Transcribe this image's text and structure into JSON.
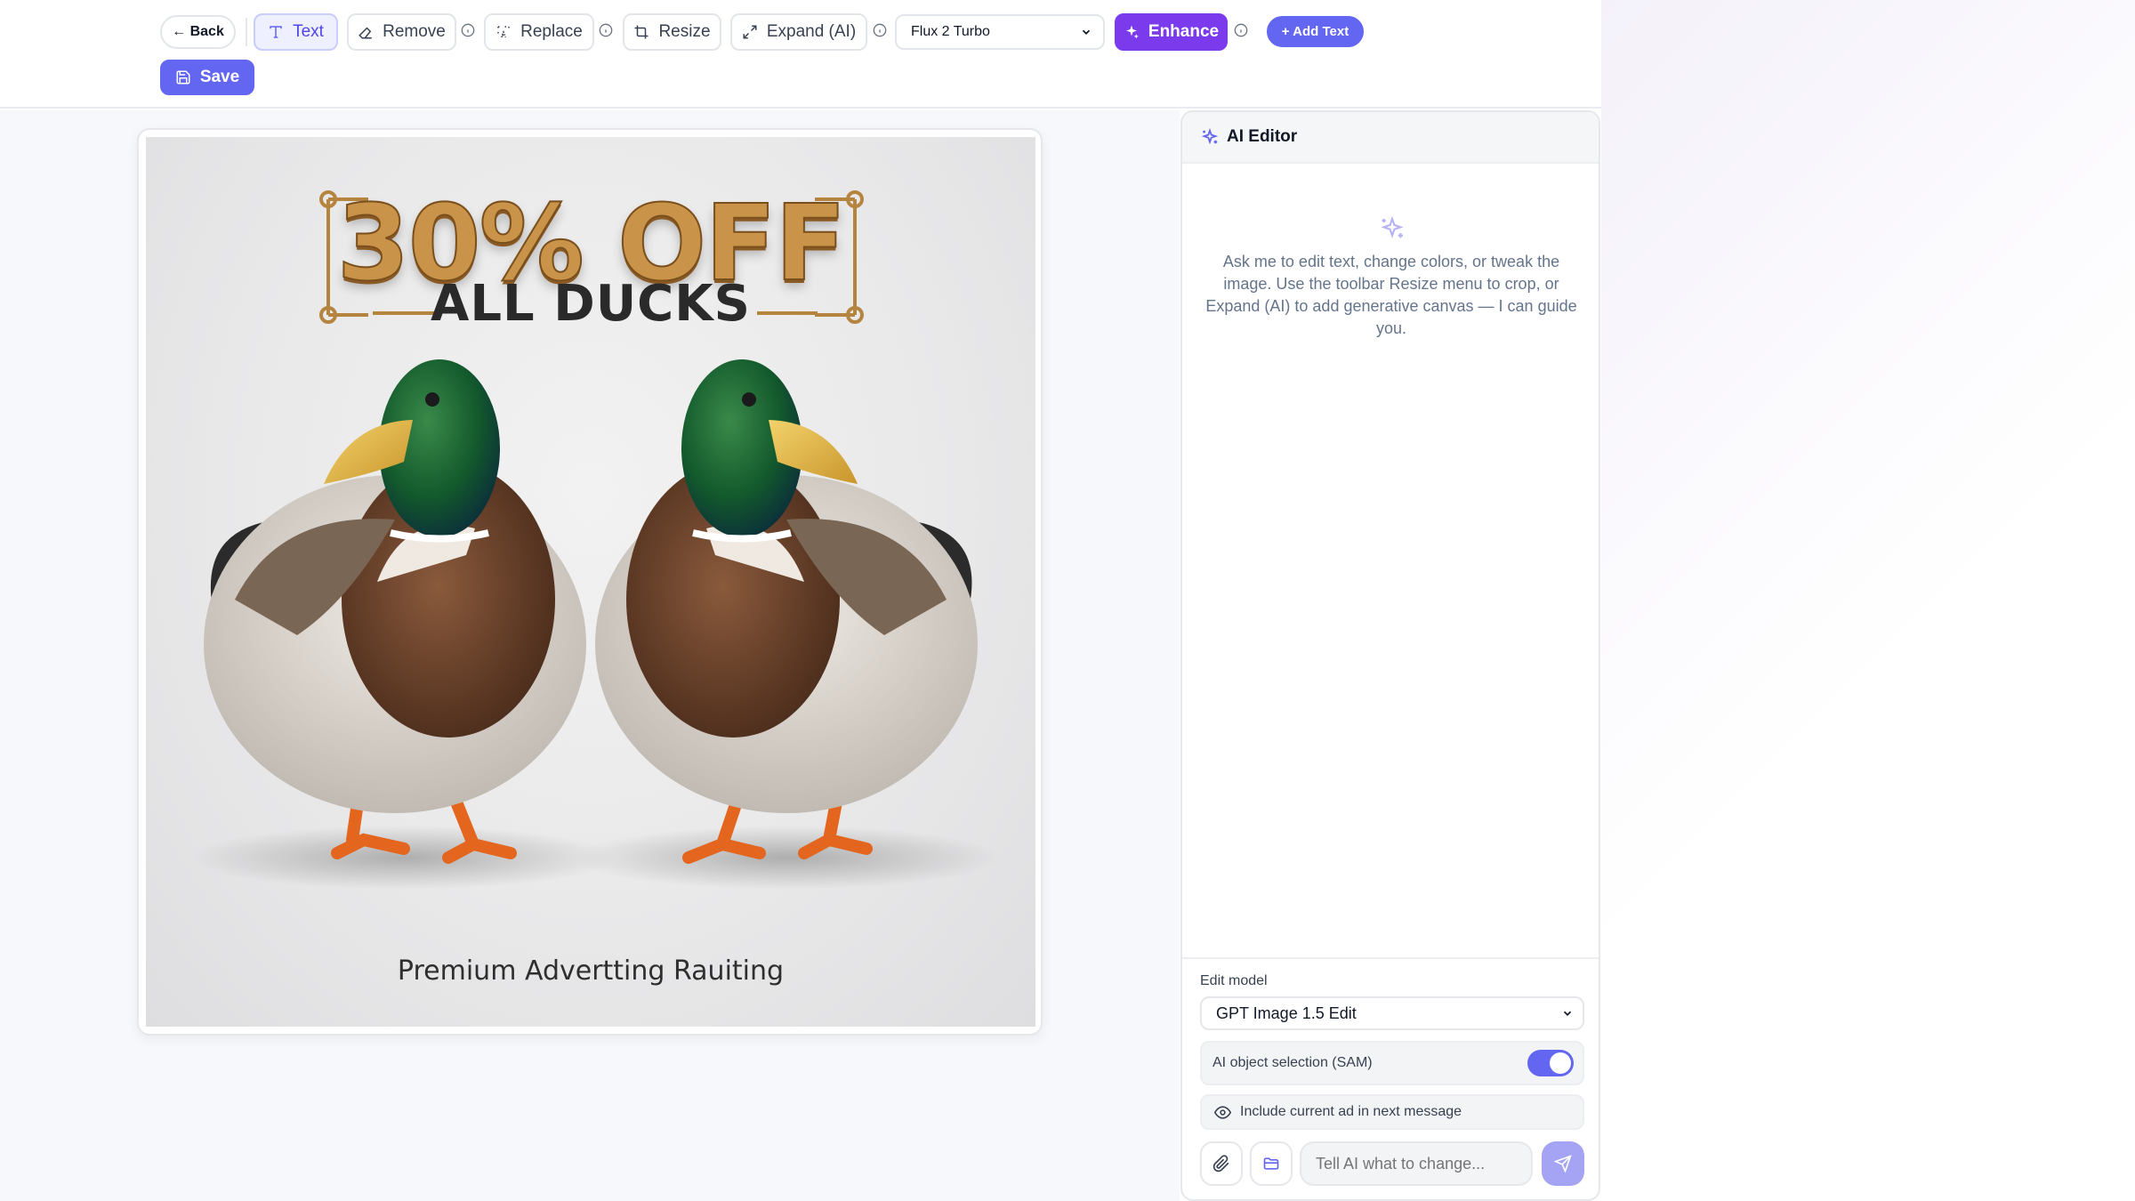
{
  "toolbar": {
    "back_label": "← Back",
    "text_label": "Text",
    "remove_label": "Remove",
    "replace_label": "Replace",
    "resize_label": "Resize",
    "expand_label": "Expand (AI)",
    "model_select_value": "Flux 2 Turbo",
    "enhance_label": "Enhance",
    "add_text_label": "+ Add Text",
    "save_label": "Save"
  },
  "ad": {
    "headline": "30% OFF",
    "subheadline": "ALL DUCKS",
    "footer_text": "Premium Advertting Rauiting"
  },
  "ai_panel": {
    "title": "AI Editor",
    "intro_text": "Ask me to edit text, change colors, or tweak the image. Use the toolbar Resize menu to crop, or Expand (AI) to add generative canvas — I can guide you.",
    "edit_model_label": "Edit model",
    "edit_model_value": "GPT Image 1.5 Edit",
    "sam_label": "AI object selection (SAM)",
    "sam_enabled": true,
    "include_ad_label": "Include current ad in next message",
    "chat_placeholder": "Tell AI what to change..."
  },
  "colors": {
    "accent_purple": "#7c3aed",
    "indigo": "#6366f1",
    "send_button": "#a5a3f3",
    "text_tool_bg": "#eef0ff"
  },
  "icons": [
    "type-icon",
    "eraser-icon",
    "replace-icon",
    "crop-icon",
    "expand-icon",
    "sparkle-icon",
    "save-icon",
    "info-icon",
    "eye-icon",
    "paperclip-icon",
    "folder-icon",
    "send-icon",
    "chevron-down-icon"
  ]
}
